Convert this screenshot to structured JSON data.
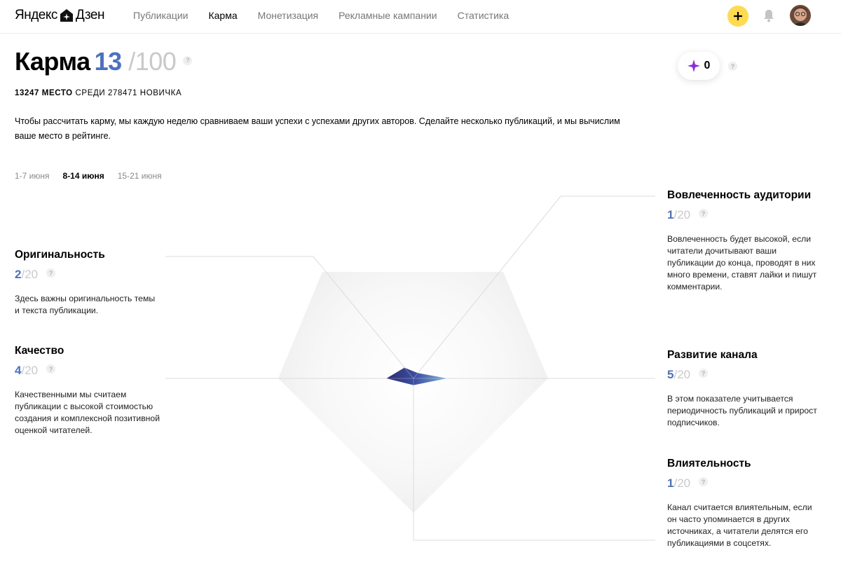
{
  "header": {
    "logo_ya": "Яндекс",
    "logo_dzen": "Дзен",
    "nav": [
      "Публикации",
      "Карма",
      "Монетизация",
      "Рекламные кампании",
      "Статистика"
    ],
    "active_nav": "Карма",
    "add_label": "+"
  },
  "karma": {
    "title": "Карма",
    "score": "13",
    "max": "/100",
    "help": "?",
    "rank_place": "13247 МЕСТО",
    "rank_rest": "СРЕДИ 278471 НОВИЧКА",
    "intro": "Чтобы рассчитать карму, мы каждую неделю сравниваем ваши успехи с успехами других авторов. Сделайте несколько публикаций, и мы вычислим ваше место в рейтинге."
  },
  "diamonds": {
    "count": "0",
    "help": "?"
  },
  "weeks": {
    "items": [
      "1-7 июня",
      "8-14 июня",
      "15-21 июня"
    ],
    "active": "8-14 июня"
  },
  "metrics": {
    "originality": {
      "title": "Оригинальность",
      "value": "2",
      "slash": "/",
      "max": "20",
      "help": "?",
      "desc": "Здесь важны оригинальность темы и текста публикации."
    },
    "quality": {
      "title": "Качество",
      "value": "4",
      "slash": "/",
      "max": "20",
      "help": "?",
      "desc": "Качественными мы считаем публикации с высокой стоимостью создания и комплексной позитивной оценкой читателей."
    },
    "engagement": {
      "title": "Вовлеченность аудитории",
      "value": "1",
      "slash": "/",
      "max": "20",
      "help": "?",
      "desc": "Вовлеченность будет высокой, если читатели дочитывают ваши публикации до конца, проводят в них много времени, ставят лайки и пишут комментарии."
    },
    "growth": {
      "title": "Развитие канала",
      "value": "5",
      "slash": "/",
      "max": "20",
      "help": "?",
      "desc": "В этом показателе учитывается периодичность публикаций и прирост подписчиков."
    },
    "influence": {
      "title": "Влиятельность",
      "value": "1",
      "slash": "/",
      "max": "20",
      "help": "?",
      "desc": "Канал считается влиятельным, если он часто упоминается в других источниках, а читатели делятся его публикациями в соцсетях."
    }
  },
  "chart_data": {
    "type": "radar",
    "max": 20,
    "axes": [
      "Вовлеченность аудитории",
      "Развитие канала",
      "Влиятельность",
      "Качество",
      "Оригинальность"
    ],
    "values": [
      1,
      5,
      1,
      4,
      2
    ]
  },
  "colors": {
    "accent": "#4a72c4",
    "add_button": "#ffdb4d",
    "diamond": "#8b2be2"
  }
}
